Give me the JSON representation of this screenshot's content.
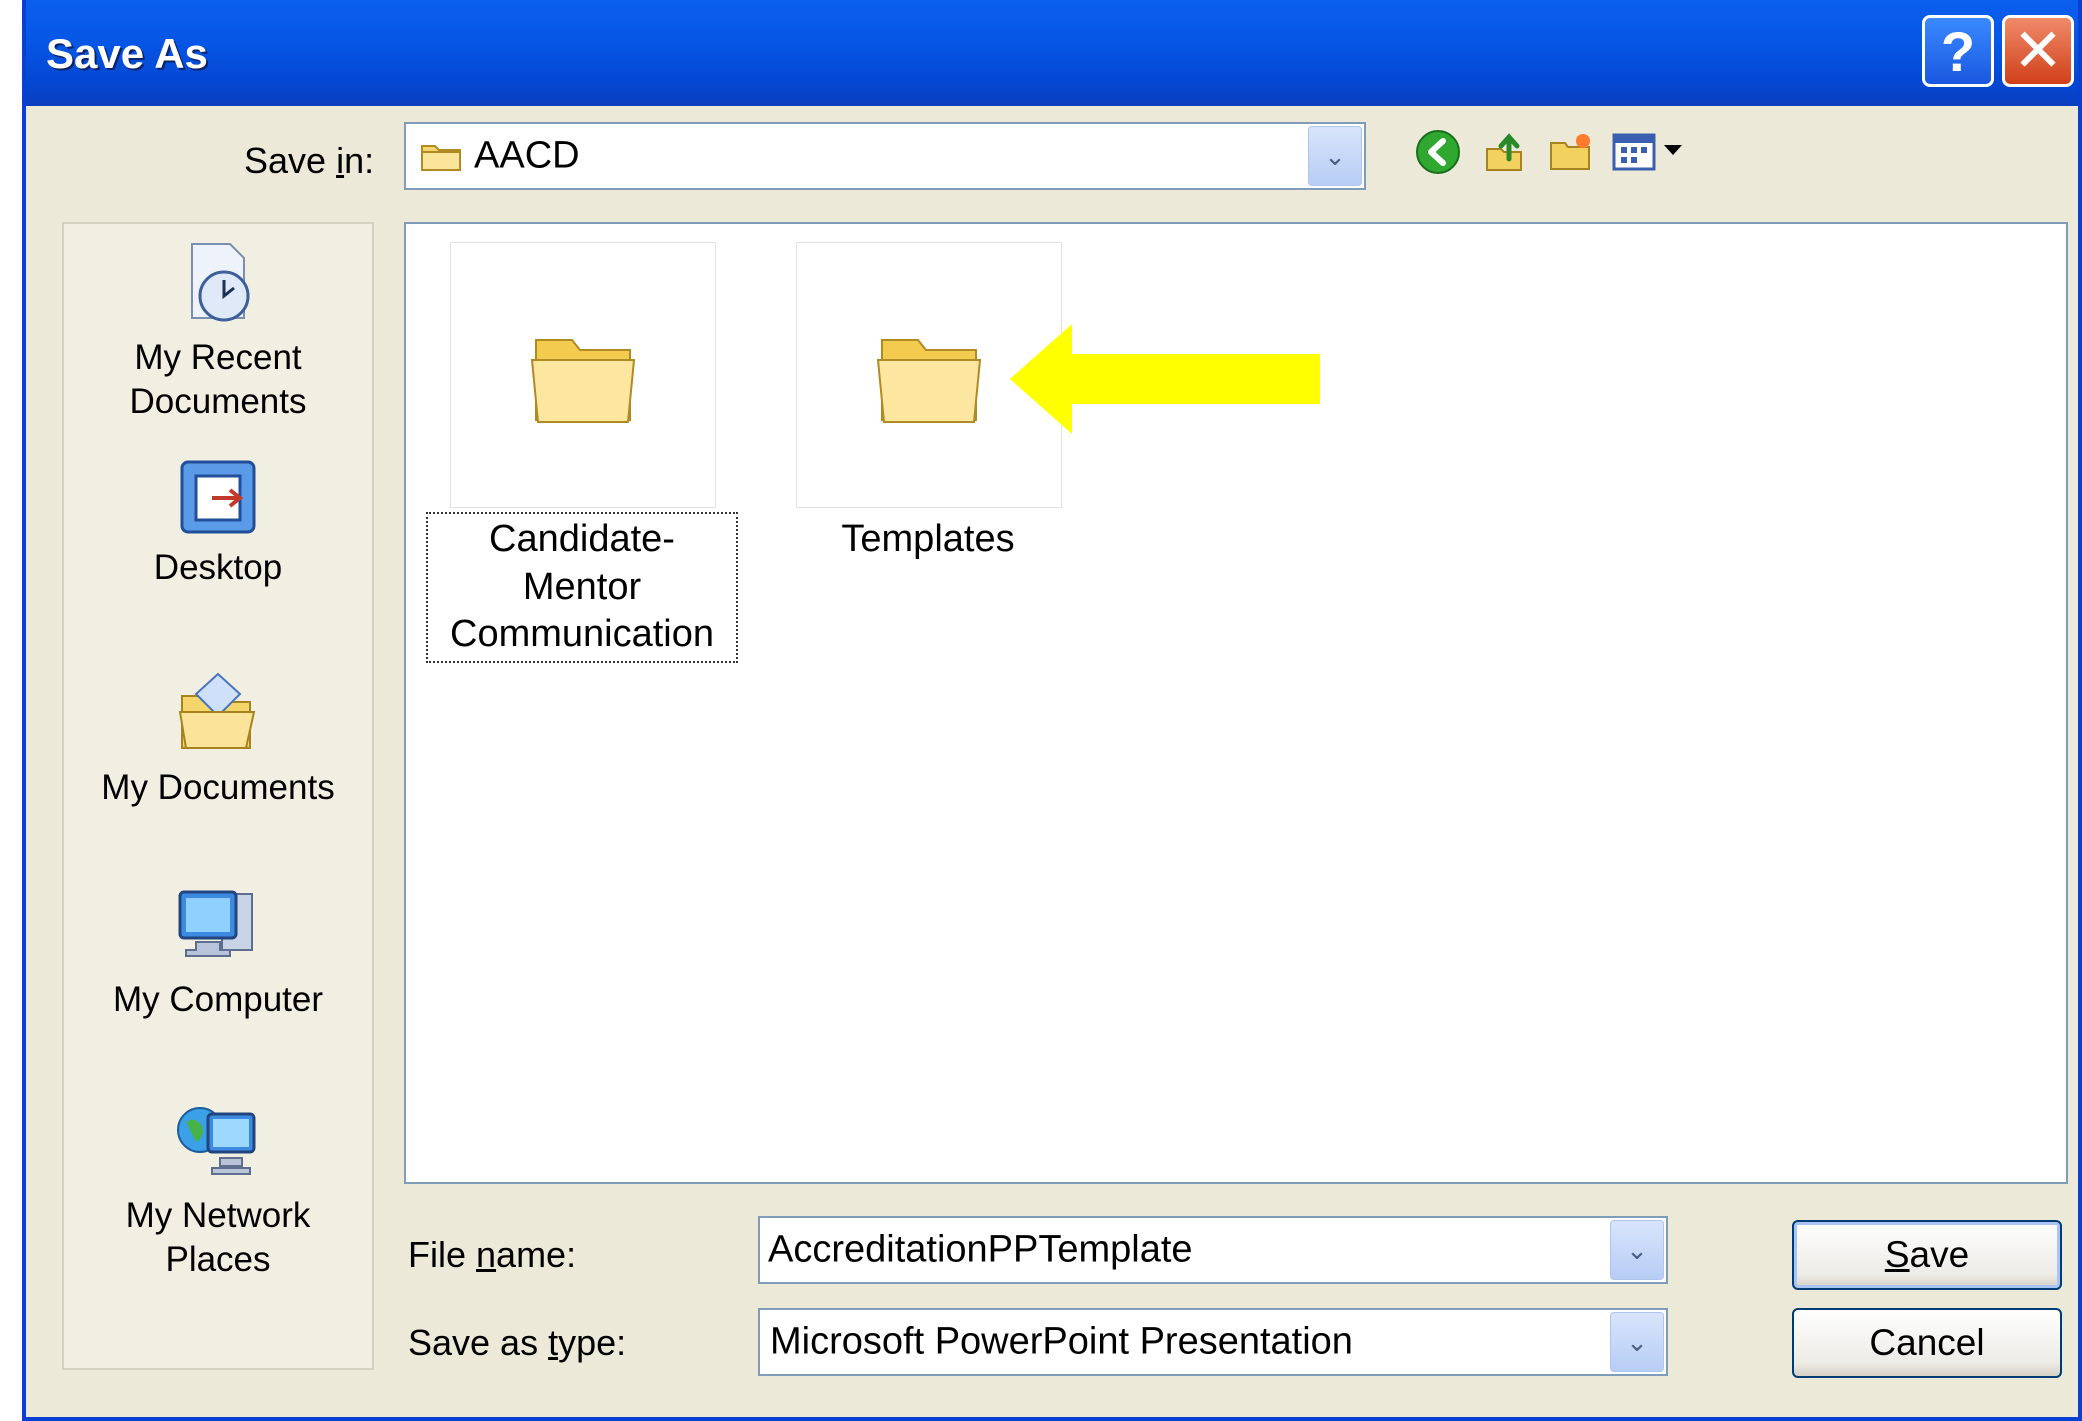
{
  "window": {
    "title": "Save As",
    "help_label": "?",
    "close_label": "✕"
  },
  "save_in": {
    "label_pre": "Save ",
    "label_mnemonic": "i",
    "label_post": "n:",
    "value": "AACD"
  },
  "toolbar": {
    "icons": [
      "back-icon",
      "up-folder-icon",
      "new-folder-icon",
      "views-menu-icon"
    ]
  },
  "places": [
    {
      "label_line1": "My Recent",
      "label_line2": "Documents",
      "icon": "recent-documents-icon"
    },
    {
      "label_line1": "Desktop",
      "label_line2": "",
      "icon": "desktop-icon"
    },
    {
      "label_line1": "My Documents",
      "label_line2": "",
      "icon": "my-documents-icon"
    },
    {
      "label_line1": "My Computer",
      "label_line2": "",
      "icon": "my-computer-icon"
    },
    {
      "label_line1": "My Network",
      "label_line2": "Places",
      "icon": "network-places-icon"
    }
  ],
  "files": [
    {
      "name_line1": "Candidate-Mentor",
      "name_line2": "Communication",
      "selected": true
    },
    {
      "name_line1": "Templates",
      "name_line2": "",
      "selected": false
    }
  ],
  "file_name": {
    "label_pre": "File ",
    "label_mnemonic": "n",
    "label_post": "ame:",
    "value": "AccreditationPPTemplate"
  },
  "save_as_type": {
    "label_pre": "Save as ",
    "label_mnemonic": "t",
    "label_post": "ype:",
    "value": "Microsoft PowerPoint Presentation"
  },
  "buttons": {
    "save_mnemonic": "S",
    "save_rest": "ave",
    "cancel": "Cancel"
  },
  "colors": {
    "titlebar": "#0756e6",
    "dialog_bg": "#ece9d8",
    "annotation_arrow": "#ffff00"
  }
}
